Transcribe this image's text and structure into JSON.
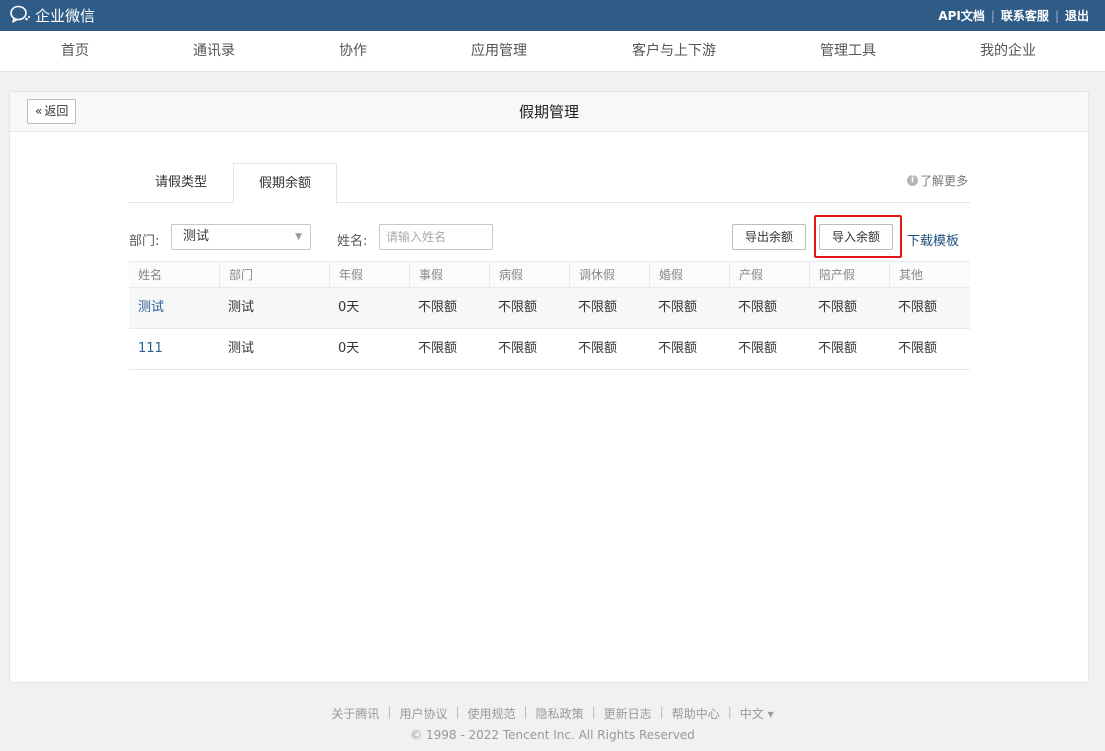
{
  "topbar": {
    "brand": "企业微信",
    "links": [
      "API文档",
      "联系客服",
      "退出"
    ]
  },
  "nav": {
    "items": [
      "首页",
      "通讯录",
      "协作",
      "应用管理",
      "客户与上下游",
      "管理工具",
      "我的企业"
    ]
  },
  "card": {
    "back_label": "返回",
    "title": "假期管理"
  },
  "tabs": [
    "请假类型",
    "假期余额"
  ],
  "active_tab": "假期余额",
  "learn_more": "了解更多",
  "filters": {
    "dept_label": "部门:",
    "dept_value": "测试",
    "name_label": "姓名:",
    "name_placeholder": "请输入姓名"
  },
  "actions": {
    "export": "导出余额",
    "import": "导入余额",
    "download": "下载模板"
  },
  "table": {
    "headers": [
      "姓名",
      "部门",
      "年假",
      "事假",
      "病假",
      "调休假",
      "婚假",
      "产假",
      "陪产假",
      "其他"
    ],
    "rows": [
      [
        "测试",
        "测试",
        "0天",
        "不限额",
        "不限额",
        "不限额",
        "不限额",
        "不限额",
        "不限额",
        "不限额"
      ],
      [
        "111",
        "测试",
        "0天",
        "不限额",
        "不限额",
        "不限额",
        "不限额",
        "不限额",
        "不限额",
        "不限额"
      ]
    ]
  },
  "footer": {
    "links": [
      "关于腾讯",
      "用户协议",
      "使用规范",
      "隐私政策",
      "更新日志",
      "帮助中心",
      "中文 ▾"
    ],
    "copyright": "© 1998 - 2022 Tencent Inc. All Rights Reserved"
  },
  "colors": {
    "topbar": "#2f5b87",
    "highlight": "#e21616",
    "link": "#1f4e7a"
  }
}
